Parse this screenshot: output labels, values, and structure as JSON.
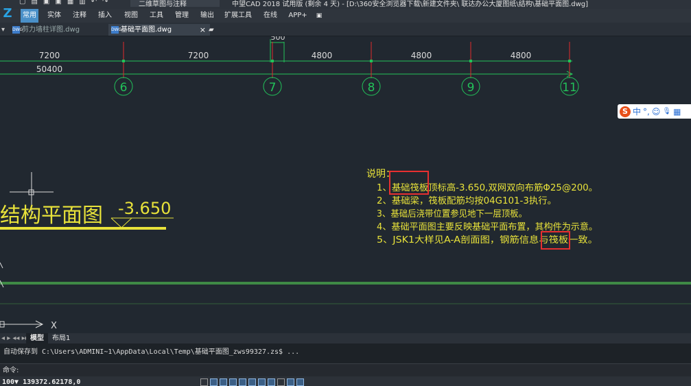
{
  "app": {
    "window_title": "中望CAD 2018 试用版 (剩余 4 天) - [D:\\360安全浏览器下载\\新建文件夹\\ 联达办公大厦图纸\\结构\\基础平面图.dwg]",
    "workspace": "二维草图与注释"
  },
  "ribbon": {
    "tabs": [
      "常用",
      "实体",
      "注释",
      "插入",
      "视图",
      "工具",
      "管理",
      "输出",
      "扩展工具",
      "在线",
      "APP+"
    ],
    "active": "常用"
  },
  "documents": {
    "tabs": [
      {
        "name": "剪力墙柱详图.dwg",
        "active": false,
        "icon": "dwg-file-icon"
      },
      {
        "name": "基础平面图.dwg",
        "active": true,
        "icon": "dwg-file-icon"
      }
    ],
    "close_symbol": "×",
    "dwg_icon_text": "DWG"
  },
  "drawing": {
    "dims_top": [
      "7200",
      "7200",
      "4800",
      "4800",
      "4800"
    ],
    "dim_small": "500",
    "dim_total": "50400",
    "axes": [
      "6",
      "7",
      "8",
      "9",
      "11"
    ],
    "plan_title": "结构平面图",
    "elevation": "-3.650",
    "ucs_x": "X",
    "notes": {
      "heading": "说明：",
      "items": [
        "1、基础筏板顶标高-3.650,双网双向布筋Φ25@200。",
        "2、基础梁，筏板配筋均按04G101-3执行。",
        "3、基础后浇带位置参见地下一层顶板。",
        "4、基础平面图主要反映基础平面布置，其构件为示意。",
        "5、JSK1大样见A-A剖面图，钢筋信息与筏板一致。"
      ]
    },
    "colors": {
      "dim_line": "#22c35a",
      "axis_red": "#e02b2b",
      "notes": "#e8e23a",
      "highlight": "#e83030",
      "title_text": "#e8e23a"
    }
  },
  "ime": {
    "logo": "S",
    "mode": "中",
    "punct": "°,",
    "emoji": "☺",
    "mic": "🎙",
    "kb": "▦"
  },
  "layout_tabs": {
    "nav": "◂ ▸ ◂◂ ▸▸",
    "tabs": [
      "模型",
      "布局1"
    ],
    "active": "模型"
  },
  "command": {
    "history": "自动保存到 C:\\Users\\ADMINI~1\\AppData\\Local\\Temp\\基础平面图_zws99327.zs$ ...",
    "prompt": "命令:"
  },
  "status": {
    "coords": "100▼ 139372.62178,0"
  }
}
